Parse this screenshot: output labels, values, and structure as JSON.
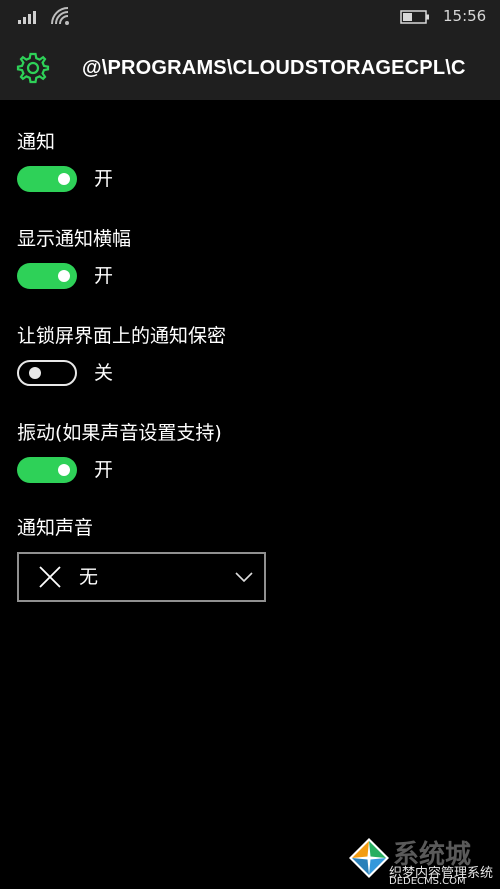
{
  "status_bar": {
    "time": "15:56",
    "icons": [
      "signal-strength-icon",
      "wifi-icon",
      "battery-icon"
    ]
  },
  "header": {
    "icon": "gear-icon",
    "title": "@\\PROGRAMS\\CLOUDSTORAGECPL\\C"
  },
  "settings": [
    {
      "label": "通知",
      "state": "开",
      "on": true
    },
    {
      "label": "显示通知横幅",
      "state": "开",
      "on": true
    },
    {
      "label": "让锁屏界面上的通知保密",
      "state": "关",
      "on": false
    },
    {
      "label": "振动(如果声音设置支持)",
      "state": "开",
      "on": true
    }
  ],
  "sound": {
    "label": "通知声音",
    "selected": "无",
    "icon": "x-icon"
  },
  "watermark": {
    "brand": "系统城",
    "line1": "织梦内容管理系统",
    "line2": "DEDECMS.COM"
  },
  "colors": {
    "accent": "#2ed158",
    "background": "#000000",
    "header_background": "#1f1f1f"
  }
}
